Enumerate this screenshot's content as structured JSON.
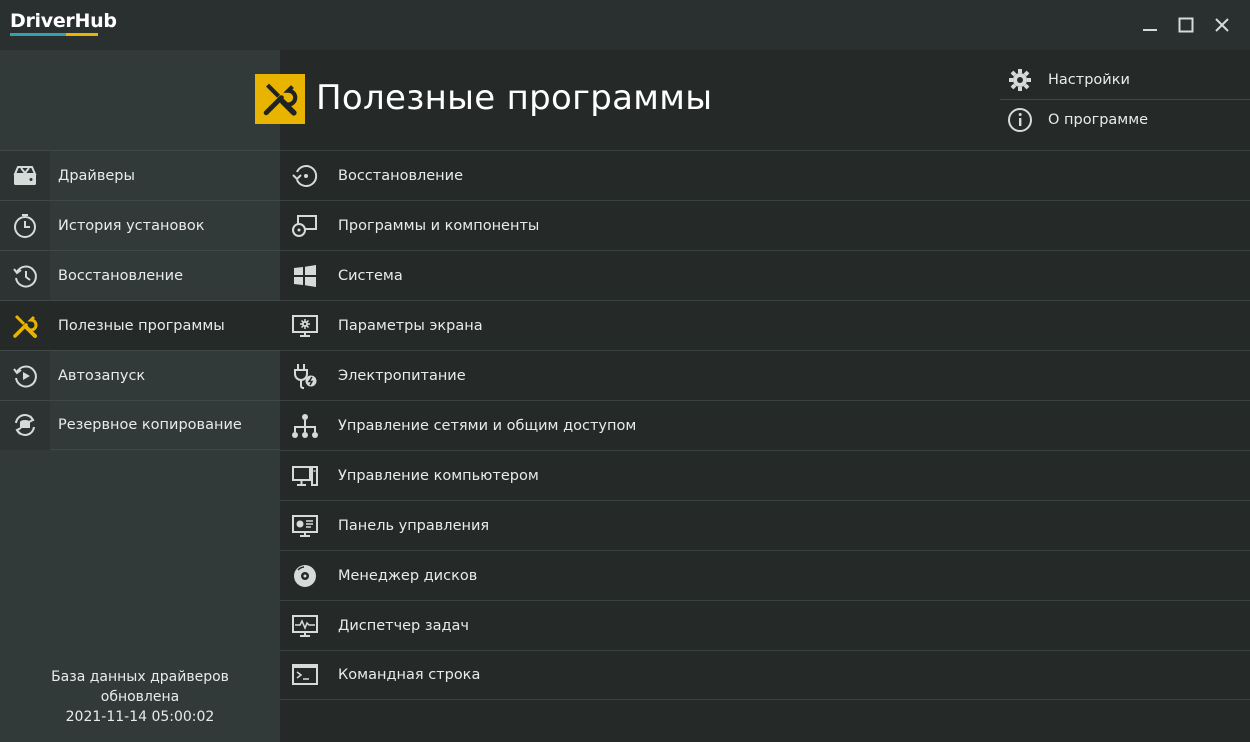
{
  "app": {
    "logo": "DriverHub",
    "brand_colors": {
      "teal": "#2fa3b0",
      "yellow": "#e8b400"
    }
  },
  "window_controls": [
    "minimize-icon",
    "maximize-icon",
    "close-icon"
  ],
  "header": {
    "title": "Полезные программы",
    "icon": "tools-icon"
  },
  "top_links": [
    {
      "label": "Настройки",
      "icon": "gear-icon"
    },
    {
      "label": "О программе",
      "icon": "info-icon"
    }
  ],
  "sidebar": {
    "items": [
      {
        "label": "Драйверы",
        "icon": "drive-icon",
        "active": false
      },
      {
        "label": "История установок",
        "icon": "clock-icon",
        "active": false
      },
      {
        "label": "Восстановление",
        "icon": "history-icon",
        "active": false
      },
      {
        "label": "Полезные программы",
        "icon": "tools-icon",
        "active": true
      },
      {
        "label": "Автозапуск",
        "icon": "autostart-icon",
        "active": false
      },
      {
        "label": "Резервное копирование",
        "icon": "backup-icon",
        "active": false
      }
    ],
    "db_status": {
      "line1": "База данных драйверов",
      "line2": "обновлена",
      "timestamp": "2021-11-14 05:00:02"
    }
  },
  "tools": [
    {
      "label": "Восстановление",
      "icon": "restore-icon"
    },
    {
      "label": "Программы и компоненты",
      "icon": "programs-icon"
    },
    {
      "label": "Система",
      "icon": "windows-icon"
    },
    {
      "label": "Параметры экрана",
      "icon": "display-settings-icon"
    },
    {
      "label": "Электропитание",
      "icon": "power-icon"
    },
    {
      "label": "Управление сетями и общим доступом",
      "icon": "network-icon"
    },
    {
      "label": "Управление компьютером",
      "icon": "computer-icon"
    },
    {
      "label": "Панель управления",
      "icon": "control-panel-icon"
    },
    {
      "label": "Менеджер дисков",
      "icon": "disk-icon"
    },
    {
      "label": "Диспетчер задач",
      "icon": "task-manager-icon"
    },
    {
      "label": "Командная строка",
      "icon": "terminal-icon"
    }
  ]
}
